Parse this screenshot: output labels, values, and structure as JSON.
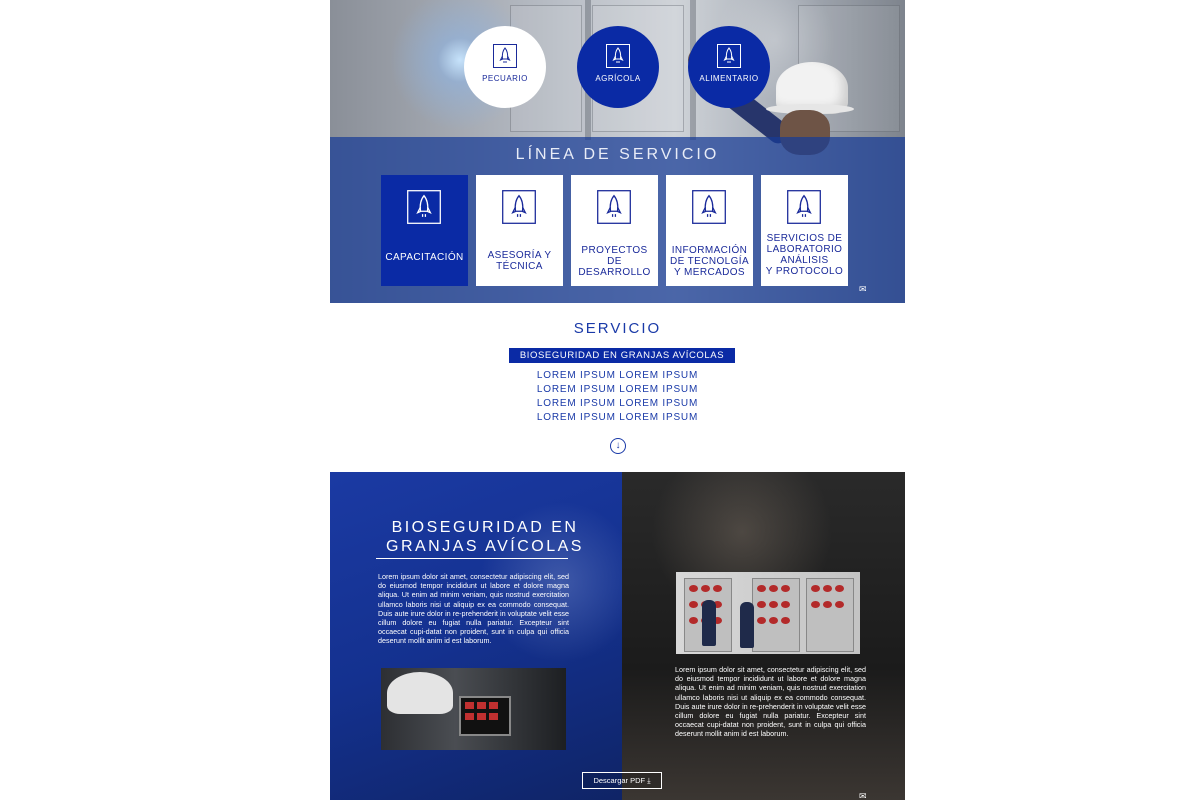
{
  "hero": {
    "circles": [
      {
        "label": "PECUARIO",
        "icon": "rocket-icon"
      },
      {
        "label": "AGRÍCOLA",
        "icon": "rocket-icon"
      },
      {
        "label": "ALIMENTARIO",
        "icon": "rocket-icon"
      }
    ]
  },
  "linea": {
    "title": "LÍNEA DE SERVICIO",
    "cards": [
      {
        "label": "CAPACITACIÓN",
        "icon": "rocket-icon",
        "active": true
      },
      {
        "label": "ASESORÍA Y\nTÉCNICA",
        "icon": "rocket-icon"
      },
      {
        "label": "PROYECTOS DE\nDESARROLLO",
        "icon": "rocket-icon"
      },
      {
        "label": "INFORMACIÓN\nDE TECNOLGÍA\nY MERCADOS",
        "icon": "rocket-icon"
      },
      {
        "label": "SERVICIOS DE\nLABORATORIO\nANÁLISIS\nY PROTOCOLO",
        "icon": "rocket-icon"
      }
    ]
  },
  "servicio": {
    "title": "SERVICIO",
    "highlight": "BIOSEGURIDAD EN GRANJAS AVÍCOLAS",
    "items": [
      "LOREM IPSUM LOREM IPSUM",
      "LOREM IPSUM LOREM IPSUM",
      "LOREM IPSUM LOREM IPSUM",
      "LOREM IPSUM LOREM IPSUM"
    ],
    "scroll_icon": "arrow-down-circle-icon"
  },
  "detalle": {
    "title_line1": "BIOSEGURIDAD EN",
    "title_line2": "GRANJAS AVÍCOLAS",
    "paragraph_left": "Lorem ipsum dolor sit amet, consectetur adipiscing elit, sed do eiusmod tempor incididunt ut labore et dolore magna aliqua. Ut enim ad minim veniam, quis nostrud exercitation ullamco laboris nisi ut aliquip ex ea commodo consequat. Duis aute irure dolor in re-prehenderit in voluptate velit esse cillum dolore eu fugiat nulla pariatur. Excepteur sint occaecat cupi-datat non proident, sunt in culpa qui officia deserunt mollit anim id est laborum.",
    "paragraph_right": "Lorem ipsum dolor sit amet, consectetur adipiscing elit, sed do eiusmod tempor incididunt ut labore et dolore magna aliqua. Ut enim ad minim veniam, quis nostrud exercitation ullamco laboris nisi ut aliquip ex ea commodo consequat. Duis aute irure dolor in re-prehenderit in voluptate velit esse cillum dolore eu fugiat nulla pariatur. Excepteur sint occaecat cupi-datat non proident, sunt in culpa qui officia deserunt mollit anim id est laborum.",
    "pdf_button": "Descargar PDF",
    "pdf_icon": "download-icon",
    "mail_icon": "envelope-icon"
  },
  "colors": {
    "brand_blue": "#0a2aa5",
    "text_blue": "#1a3aa8",
    "band_blue": "#183c96"
  }
}
